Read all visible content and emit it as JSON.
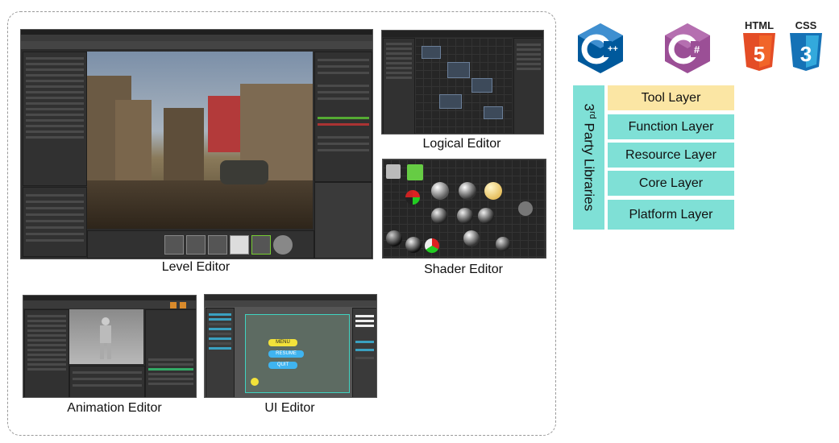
{
  "captions": {
    "level_editor": "Level Editor",
    "logical_editor": "Logical Editor",
    "shader_editor": "Shader Editor",
    "animation_editor": "Animation Editor",
    "ui_editor": "UI Editor"
  },
  "logos": {
    "cpp": {
      "icon": "cpp-icon",
      "color": "#00599c"
    },
    "csharp": {
      "icon": "csharp-icon",
      "color": "#9b4f96"
    },
    "html": {
      "label": "HTML",
      "number": "5",
      "color": "#e44d26"
    },
    "css": {
      "label": "CSS",
      "number": "3",
      "color": "#1572b6"
    }
  },
  "third_party": {
    "prefix": "3",
    "sup": "rd",
    "suffix": " Party Libraries"
  },
  "layers": [
    {
      "label": "Tool Layer",
      "color": "#fbe6a4"
    },
    {
      "label": "Function Layer",
      "color": "#7fe0d6"
    },
    {
      "label": "Resource Layer",
      "color": "#7fe0d6"
    },
    {
      "label": "Core Layer",
      "color": "#7fe0d6"
    },
    {
      "label": "Platform Layer",
      "color": "#7fe0d6"
    }
  ],
  "ui_editor_buttons": [
    "MENU",
    "RESUME",
    "QUIT"
  ]
}
